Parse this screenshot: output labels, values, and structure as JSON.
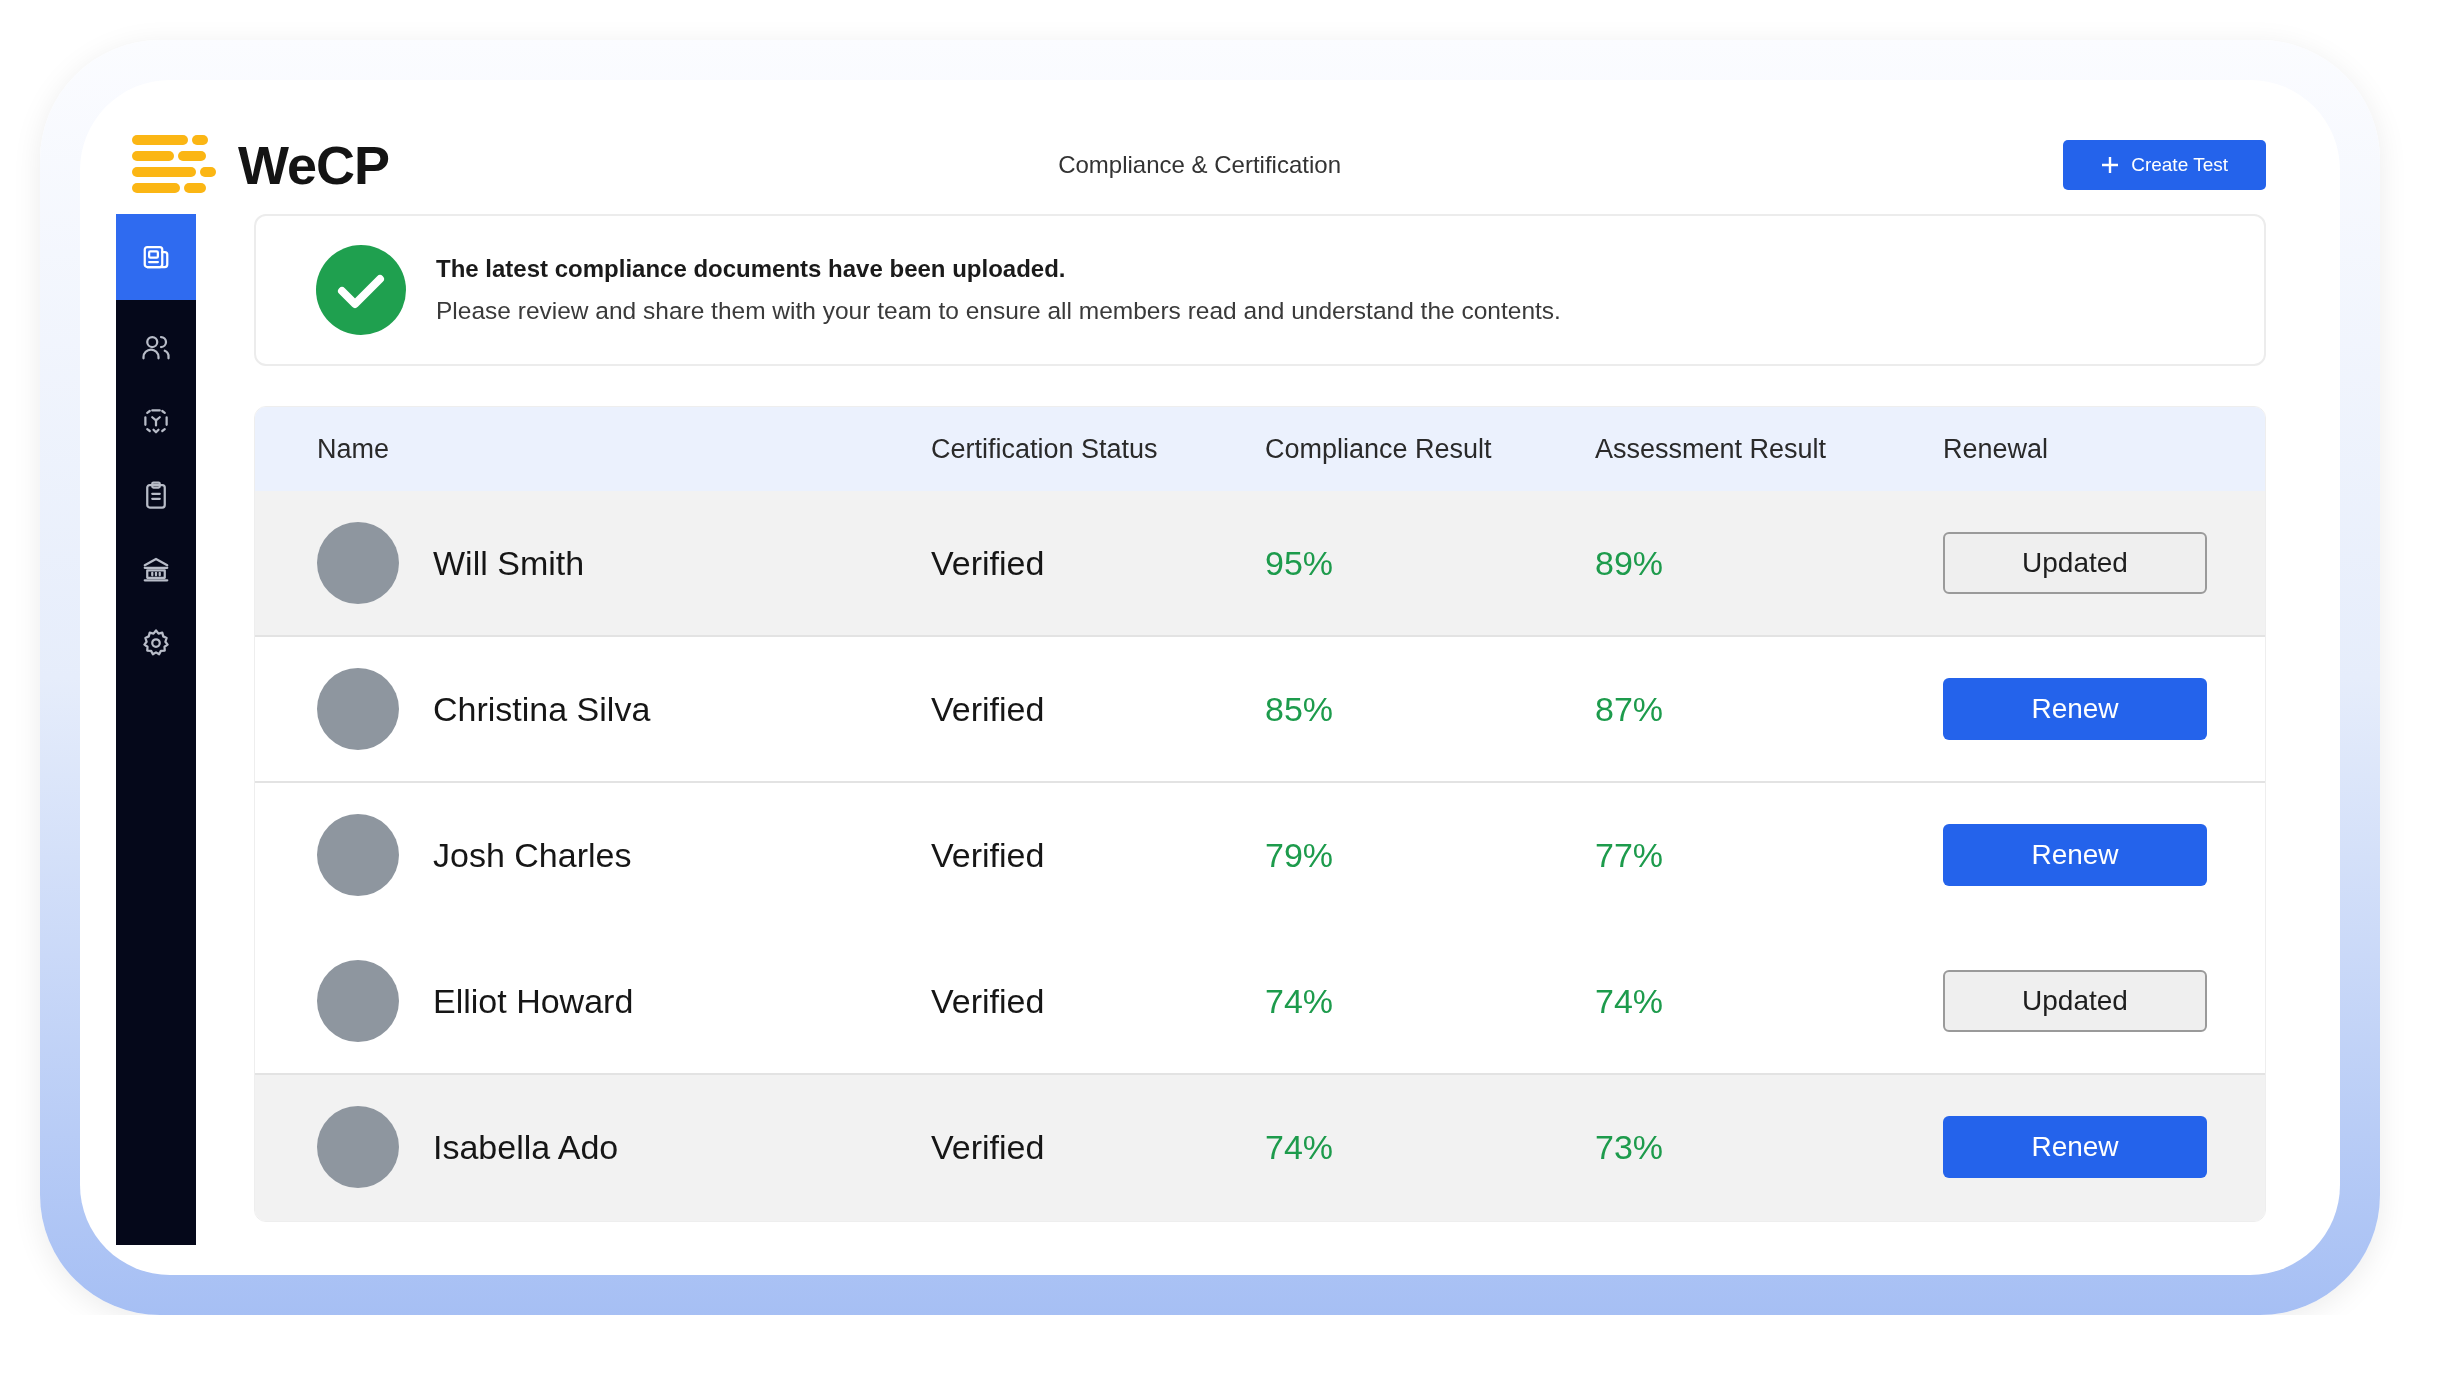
{
  "header": {
    "logo_text": "WeCP",
    "title": "Compliance & Certification",
    "create_button": "Create Test"
  },
  "sidebar": {
    "items": [
      {
        "selected": true
      },
      {
        "selected": false
      },
      {
        "selected": false
      },
      {
        "selected": false
      },
      {
        "selected": false
      },
      {
        "selected": false
      }
    ]
  },
  "banner": {
    "title": "The latest compliance documents have been uploaded.",
    "message": "Please review and share them with your team to ensure all members read and understand the contents."
  },
  "table": {
    "columns": [
      "Name",
      "Certification Status",
      "Compliance Result",
      "Assessment Result",
      "Renewal"
    ],
    "rows": [
      {
        "name": "Will Smith",
        "status": "Verified",
        "compliance": "95%",
        "assessment": "89%",
        "renewal": {
          "kind": "updated",
          "label": "Updated"
        },
        "shaded": true
      },
      {
        "name": "Christina Silva",
        "status": "Verified",
        "compliance": "85%",
        "assessment": "87%",
        "renewal": {
          "kind": "renew",
          "label": "Renew"
        },
        "shaded": false
      },
      {
        "name": "Josh Charles",
        "status": "Verified",
        "compliance": "79%",
        "assessment": "77%",
        "renewal": {
          "kind": "renew",
          "label": "Renew"
        },
        "shaded": false
      },
      {
        "name": "Elliot Howard",
        "status": "Verified",
        "compliance": "74%",
        "assessment": "74%",
        "renewal": {
          "kind": "updated",
          "label": "Updated"
        },
        "shaded": false
      },
      {
        "name": "Isabella Ado",
        "status": "Verified",
        "compliance": "74%",
        "assessment": "73%",
        "renewal": {
          "kind": "renew",
          "label": "Renew"
        },
        "shaded": true
      }
    ]
  }
}
